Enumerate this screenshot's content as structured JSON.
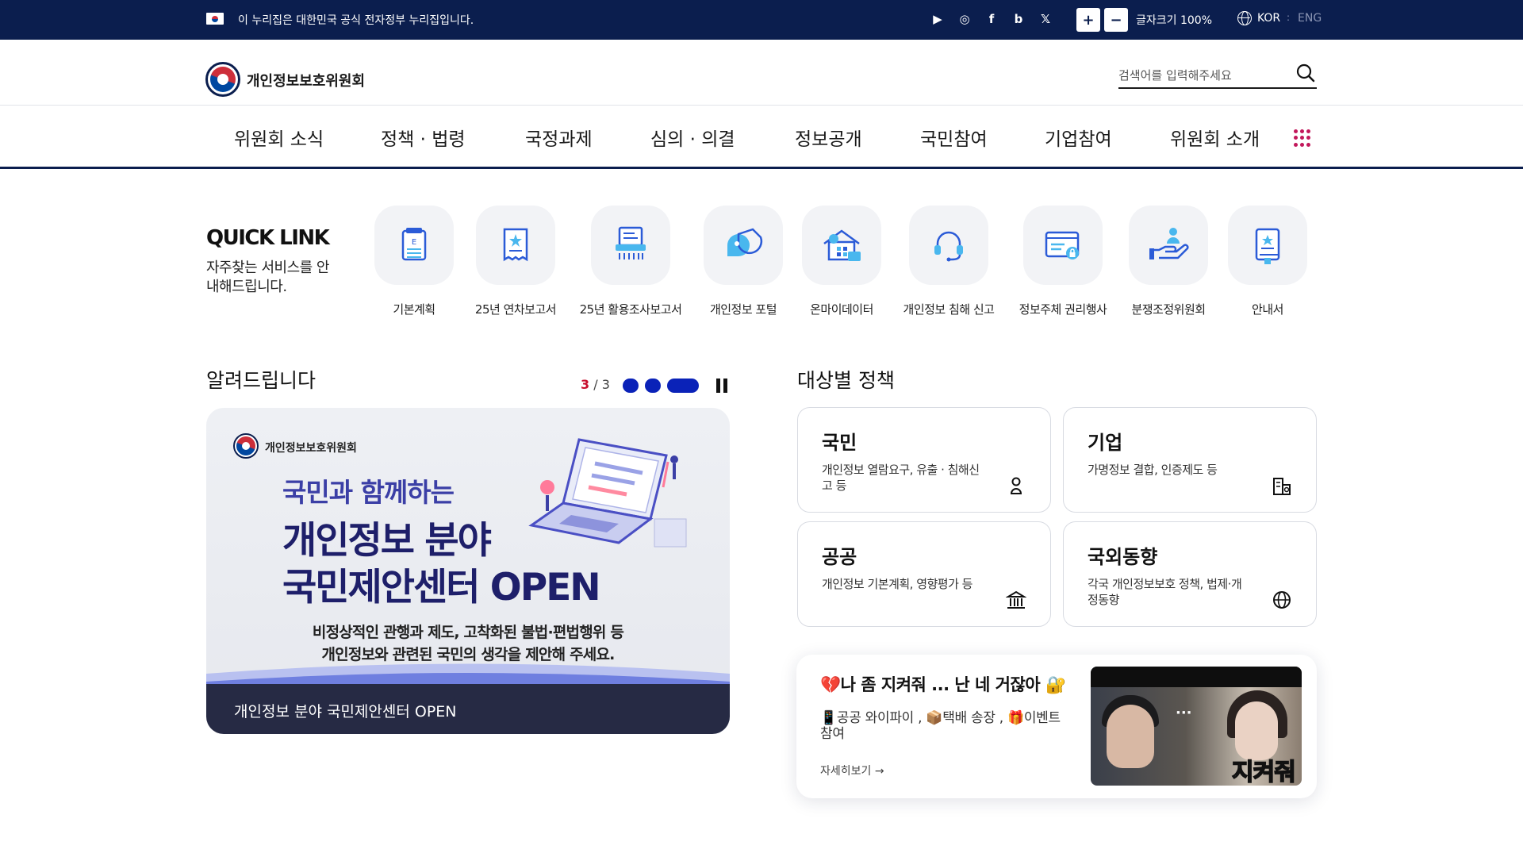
{
  "topbar": {
    "gov_notice": "이 누리집은 대한민국 공식 전자정부 누리집입니다.",
    "social": [
      {
        "name": "youtube-icon",
        "glyph": "▶"
      },
      {
        "name": "instagram-icon",
        "glyph": "◎"
      },
      {
        "name": "facebook-icon",
        "glyph": "f"
      },
      {
        "name": "blog-icon",
        "glyph": "b"
      },
      {
        "name": "x-icon",
        "glyph": "𝕏"
      }
    ],
    "font_plus": "+",
    "font_minus": "−",
    "font_size_label": "글자크기 100%",
    "lang_current": "KOR",
    "lang_sep": ":",
    "lang_other": "ENG"
  },
  "header": {
    "logo_text": "개인정보보호위원회",
    "search_placeholder": "검색어를 입력해주세요"
  },
  "gnb": {
    "items": [
      "위원회 소식",
      "정책 · 법령",
      "국정과제",
      "심의 · 의결",
      "정보공개",
      "국민참여",
      "기업참여",
      "위원회 소개"
    ],
    "all_menu_icon": "grid-menu-icon"
  },
  "quicklink": {
    "title": "QUICK LINK",
    "subtitle": "자주찾는 서비스를 안내해드립니다.",
    "items": [
      {
        "label": "기본계획",
        "icon": "plan-document-icon"
      },
      {
        "label": "25년 연차보고서",
        "icon": "annual-report-icon"
      },
      {
        "label": "25년 활용조사보고서",
        "icon": "survey-report-icon"
      },
      {
        "label": "개인정보 포털",
        "icon": "portal-icon"
      },
      {
        "label": "온마이데이터",
        "icon": "mydata-icon"
      },
      {
        "label": "개인정보 침해 신고",
        "icon": "headset-icon"
      },
      {
        "label": "정보주체 권리행사",
        "icon": "rights-icon"
      },
      {
        "label": "분쟁조정위원회",
        "icon": "mediation-icon"
      },
      {
        "label": "안내서",
        "icon": "guidebook-icon"
      }
    ]
  },
  "notice": {
    "title": "알려드립니다",
    "slide_current": "3",
    "slide_total": "/ 3",
    "banner": {
      "org": "개인정보보호위원회",
      "line1": "국민과 함께하는",
      "line2": "개인정보 분야",
      "line3": "국민제안센터 OPEN",
      "desc1": "비정상적인 관행과 제도, 고착화된 불법·편법행위 등",
      "desc2": "개인정보와 관련된 국민의 생각을 제안해 주세요.",
      "caption": "개인정보 분야 국민제안센터 OPEN"
    }
  },
  "policy": {
    "title": "대상별 정책",
    "cards": [
      {
        "title": "국민",
        "desc": "개인정보 열람요구, 유출 · 침해신고 등",
        "icon": "person-icon"
      },
      {
        "title": "기업",
        "desc": "가명정보 결합, 인증제도 등",
        "icon": "building-icon"
      },
      {
        "title": "공공",
        "desc": "개인정보 기본계획, 영향평가 등",
        "icon": "public-building-icon"
      },
      {
        "title": "국외동향",
        "desc": "각국 개인정보보호 정책, 법제·개정동향",
        "icon": "globe-icon"
      }
    ]
  },
  "video": {
    "title": "💔나 좀 지켜줘 ... 난 네 거잖아 🔐",
    "desc": "📱공공 와이파이 , 📦택배 송장 , 🎁이벤트 참여",
    "more": "자세히보기 →",
    "thumb_dots": "···",
    "thumb_text1": "지켜줘"
  },
  "colors": {
    "navy": "#0b1e4e",
    "accent_blue": "#0a22b8",
    "accent_red": "#c8102e",
    "gnb_all_dots": "#c2185b"
  }
}
